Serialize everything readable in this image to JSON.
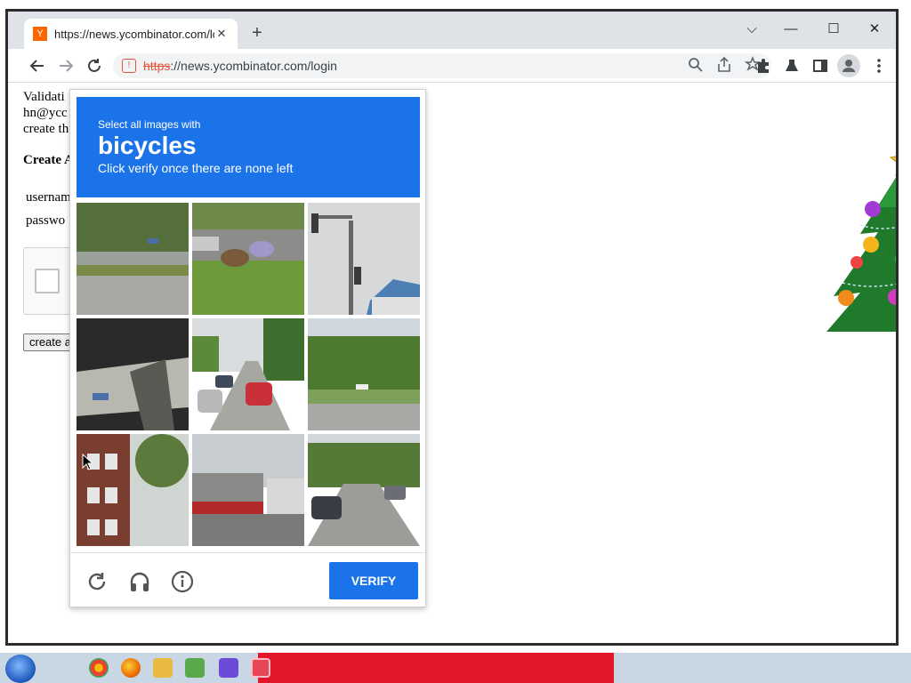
{
  "browser": {
    "tab_title": "https://news.ycombinator.com/lo",
    "tab_favicon_letter": "Y",
    "tab_close": "✕",
    "new_tab": "+",
    "window_controls": {
      "dropdown": "⌵",
      "minimize": "—",
      "maximize": "☐",
      "close": "✕"
    },
    "address": {
      "scheme": "https",
      "rest": "://news.ycombinator.com/login"
    }
  },
  "page": {
    "validation_line1": "Validati",
    "validation_line2": "hn@ycc",
    "validation_line3": "create th",
    "create_heading": "Create A",
    "username_label": "usernam",
    "password_label": "passwo",
    "create_button": "create a"
  },
  "captcha": {
    "instruction": "Select all images with",
    "target": "bicycles",
    "hint": "Click verify once there are none left",
    "verify_label": "VERIFY",
    "tiles": [
      {
        "name": "tile-road-trees"
      },
      {
        "name": "tile-motorcycles"
      },
      {
        "name": "tile-traffic-light"
      },
      {
        "name": "tile-overpass"
      },
      {
        "name": "tile-street-cars"
      },
      {
        "name": "tile-trees-lawn"
      },
      {
        "name": "tile-brick-building"
      },
      {
        "name": "tile-storefront"
      },
      {
        "name": "tile-residential-street"
      }
    ],
    "icons": [
      "reload-icon",
      "audio-icon",
      "info-icon"
    ]
  },
  "colors": {
    "accent": "#1a73e8",
    "insecure": "#e2553a",
    "taskbar_red": "#e3172a"
  }
}
